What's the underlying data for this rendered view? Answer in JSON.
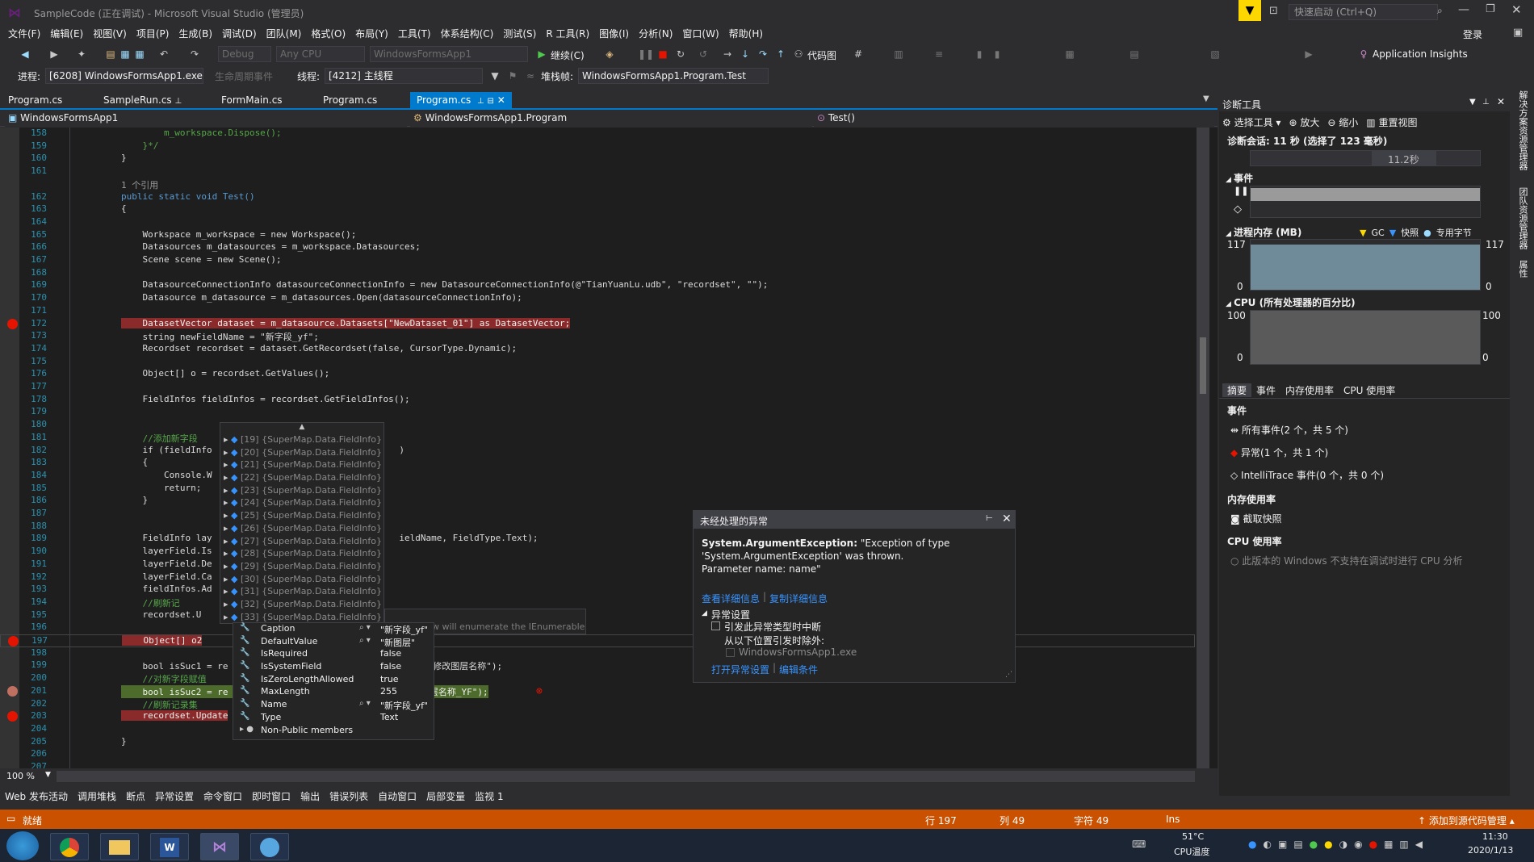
{
  "titlebar": {
    "title": "SampleCode (正在调试) - Microsoft Visual Studio (管理员)",
    "quicklaunch_placeholder": "快速启动 (Ctrl+Q)",
    "login": "登录"
  },
  "menu": [
    "文件(F)",
    "编辑(E)",
    "视图(V)",
    "项目(P)",
    "生成(B)",
    "调试(D)",
    "团队(M)",
    "格式(O)",
    "布局(Y)",
    "工具(T)",
    "体系结构(C)",
    "测试(S)",
    "R 工具(R)",
    "图像(I)",
    "分析(N)",
    "窗口(W)",
    "帮助(H)"
  ],
  "toolbar": {
    "config": "Debug",
    "platform": "Any CPU",
    "project": "WindowsFormsApp1",
    "continue": "继续(C)",
    "codemap": "代码图",
    "insights": "Application Insights"
  },
  "toolbar2": {
    "process_label": "进程:",
    "process": "[6208] WindowsFormsApp1.exe",
    "lifecycle": "生命周期事件",
    "thread_label": "线程:",
    "thread": "[4212] 主线程",
    "stack_label": "堆栈帧:",
    "stack": "WindowsFormsApp1.Program.Test"
  },
  "doctabs": [
    "Program.cs",
    "SampleRun.cs",
    "FormMain.cs",
    "Program.cs",
    "Program.cs"
  ],
  "navbar": {
    "project": "WindowsFormsApp1",
    "class": "WindowsFormsApp1.Program",
    "member": "Test()"
  },
  "lines": [
    {
      "n": "158",
      "t": "        m_workspace.Dispose();",
      "c": "cm"
    },
    {
      "n": "159",
      "t": "    }*/",
      "c": "cm"
    },
    {
      "n": "160",
      "t": "}",
      "c": ""
    },
    {
      "n": "161",
      "t": "",
      "c": ""
    },
    {
      "n": "",
      "t": "1 个引用",
      "c": "gy"
    },
    {
      "n": "162",
      "t": "public static void Test()",
      "c": "kwline"
    },
    {
      "n": "163",
      "t": "{",
      "c": ""
    },
    {
      "n": "164",
      "t": "",
      "c": ""
    },
    {
      "n": "165",
      "t": "    Workspace m_workspace = new Workspace();",
      "c": ""
    },
    {
      "n": "166",
      "t": "    Datasources m_datasources = m_workspace.Datasources;",
      "c": ""
    },
    {
      "n": "167",
      "t": "    Scene scene = new Scene();",
      "c": ""
    },
    {
      "n": "168",
      "t": "",
      "c": ""
    },
    {
      "n": "169",
      "t": "    DatasourceConnectionInfo datasourceConnectionInfo = new DatasourceConnectionInfo(@\"TianYuanLu.udb\", \"recordset\", \"\");",
      "c": ""
    },
    {
      "n": "170",
      "t": "    Datasource m_datasource = m_datasources.Open(datasourceConnectionInfo);",
      "c": ""
    },
    {
      "n": "171",
      "t": "",
      "c": ""
    },
    {
      "n": "172",
      "t": "    DatasetVector dataset = m_datasource.Datasets[\"NewDataset_01\"] as DatasetVector;",
      "c": "bp"
    },
    {
      "n": "173",
      "t": "    string newFieldName = \"新字段_yf\";",
      "c": ""
    },
    {
      "n": "174",
      "t": "    Recordset recordset = dataset.GetRecordset(false, CursorType.Dynamic);",
      "c": ""
    },
    {
      "n": "175",
      "t": "",
      "c": ""
    },
    {
      "n": "176",
      "t": "    Object[] o = recordset.GetValues();",
      "c": ""
    },
    {
      "n": "177",
      "t": "",
      "c": ""
    },
    {
      "n": "178",
      "t": "    FieldInfos fieldInfos = recordset.GetFieldInfos();",
      "c": ""
    },
    {
      "n": "179",
      "t": "",
      "c": ""
    },
    {
      "n": "180",
      "t": "",
      "c": ""
    },
    {
      "n": "181",
      "t": "    //添加新字段",
      "c": "cm"
    },
    {
      "n": "182",
      "t": "    if (fieldInfo                                   )",
      "c": ""
    },
    {
      "n": "183",
      "t": "    {",
      "c": ""
    },
    {
      "n": "184",
      "t": "        Console.W",
      "c": ""
    },
    {
      "n": "185",
      "t": "        return;",
      "c": ""
    },
    {
      "n": "186",
      "t": "    }",
      "c": ""
    },
    {
      "n": "187",
      "t": "",
      "c": ""
    },
    {
      "n": "188",
      "t": "",
      "c": ""
    },
    {
      "n": "189",
      "t": "    FieldInfo lay                                   ieldName, FieldType.Text);",
      "c": ""
    },
    {
      "n": "190",
      "t": "    layerField.Is",
      "c": ""
    },
    {
      "n": "191",
      "t": "    layerField.De",
      "c": ""
    },
    {
      "n": "192",
      "t": "    layerField.Ca",
      "c": ""
    },
    {
      "n": "193",
      "t": "    fieldInfos.Ad",
      "c": ""
    },
    {
      "n": "194",
      "t": "    //刷新记",
      "c": "cm"
    },
    {
      "n": "195",
      "t": "    recordset.U",
      "c": ""
    },
    {
      "n": "196",
      "t": "",
      "c": ""
    },
    {
      "n": "197",
      "t": "    Object[] o2",
      "c": "bp2"
    },
    {
      "n": "198",
      "t": "",
      "c": ""
    },
    {
      "n": "199",
      "t": "    bool isSuc1 = re                                   测试修改图层名称\");",
      "c": ""
    },
    {
      "n": "200",
      "t": "    //对新字段赋值",
      "c": "cm"
    },
    {
      "n": "201",
      "t": "    bool isSuc2 = re                                   \"图层名称_YF\");",
      "c": "cur"
    },
    {
      "n": "202",
      "t": "    //刷新记录集",
      "c": "cm"
    },
    {
      "n": "203",
      "t": "    recordset.Update",
      "c": "bp"
    },
    {
      "n": "204",
      "t": "",
      "c": ""
    },
    {
      "n": "205",
      "t": "}",
      "c": ""
    },
    {
      "n": "206",
      "t": "",
      "c": ""
    },
    {
      "n": "207",
      "t": "",
      "c": ""
    }
  ],
  "datatip": {
    "items": [
      "[19] {SuperMap.Data.FieldInfo}",
      "[20] {SuperMap.Data.FieldInfo}",
      "[21] {SuperMap.Data.FieldInfo}",
      "[22] {SuperMap.Data.FieldInfo}",
      "[23] {SuperMap.Data.FieldInfo}",
      "[24] {SuperMap.Data.FieldInfo}",
      "[25] {SuperMap.Data.FieldInfo}",
      "[26] {SuperMap.Data.FieldInfo}",
      "[27] {SuperMap.Data.FieldInfo}",
      "[28] {SuperMap.Data.FieldInfo}",
      "[29] {SuperMap.Data.FieldInfo}",
      "[30] {SuperMap.Data.FieldInfo}",
      "[31] {SuperMap.Data.FieldInfo}",
      "[32] {SuperMap.Data.FieldInfo}",
      "[33] {SuperMap.Data.FieldInfo}"
    ],
    "props": [
      {
        "name": "Caption",
        "value": "\"新字段_yf\""
      },
      {
        "name": "DefaultValue",
        "value": "\"新图层\""
      },
      {
        "name": "IsRequired",
        "value": "false"
      },
      {
        "name": "IsSystemField",
        "value": "false"
      },
      {
        "name": "IsZeroLengthAllowed",
        "value": "true"
      },
      {
        "name": "MaxLength",
        "value": "255"
      },
      {
        "name": "Name",
        "value": "\"新字段_yf\""
      },
      {
        "name": "Type",
        "value": "Text"
      },
      {
        "name": "Non-Public members",
        "value": ""
      }
    ],
    "enumerate_hint": "w will enumerate the IEnumerable"
  },
  "exception": {
    "title": "未经处理的异常",
    "type": "System.ArgumentException:",
    "msg1": "\"Exception of type",
    "msg2": "'System.ArgumentException' was thrown.",
    "msg3": "Parameter name: name\"",
    "link_detail": "查看详细信息",
    "link_copy": "复制详细信息",
    "settings": "异常设置",
    "cb_break": "引发此异常类型时中断",
    "except_from": "从以下位置引发时除外:",
    "cb_exe": "WindowsFormsApp1.exe",
    "link_open": "打开异常设置",
    "link_edit": "编辑条件"
  },
  "diag": {
    "title": "诊断工具",
    "select_tool": "选择工具",
    "zoom_in": "放大",
    "zoom_out": "缩小",
    "reset": "重置视图",
    "session": "诊断会话: 11 秒 (选择了 123 毫秒)",
    "time_marker": "11.2秒",
    "events": "事件",
    "memory": "进程内存 (MB)",
    "gc": "GC",
    "snapshot": "快照",
    "private": "专用字节",
    "mem_max": "117",
    "mem_min": "0",
    "cpu": "CPU (所有处理器的百分比)",
    "cpu_max": "100",
    "cpu_min": "0",
    "tabs": [
      "摘要",
      "事件",
      "内存使用率",
      "CPU 使用率"
    ],
    "sec_events": "事件",
    "all_events": "所有事件(2 个，共 5 个)",
    "exceptions": "异常(1 个，共 1 个)",
    "intellitrace": "IntelliTrace 事件(0 个，共 0 个)",
    "sec_mem": "内存使用率",
    "take_snapshot": "截取快照",
    "sec_cpu": "CPU 使用率",
    "cpu_note": "此版本的 Windows 不支持在调试时进行 CPU 分析"
  },
  "rstrip": [
    "解决方案资源管理器",
    "团队资源管理器",
    "属性"
  ],
  "zoom": "100 %",
  "bottomtabs": [
    "Web 发布活动",
    "调用堆栈",
    "断点",
    "异常设置",
    "命令窗口",
    "即时窗口",
    "输出",
    "错误列表",
    "自动窗口",
    "局部变量",
    "监视 1"
  ],
  "status": {
    "ready": "就绪",
    "line": "行 197",
    "col": "列 49",
    "char": "字符 49",
    "ins": "Ins",
    "scm": "添加到源代码管理"
  },
  "tray": {
    "temp": "51°C",
    "temp_label": "CPU温度",
    "time": "11:30",
    "date": "2020/1/13"
  }
}
